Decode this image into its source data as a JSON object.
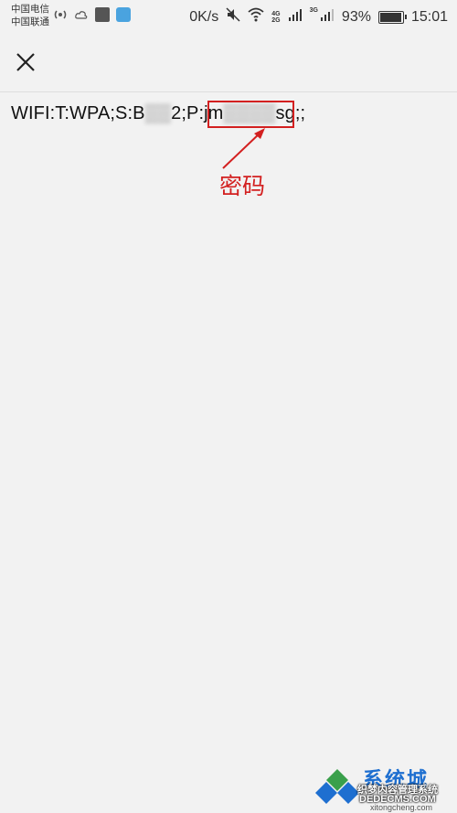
{
  "status_bar": {
    "carrier_1": "中国电信",
    "carrier_2": "中国联通",
    "net_speed": "0K/s",
    "net_4g": "4G",
    "net_2g": "2G",
    "net_3g": "3G",
    "battery": "93%",
    "time": "15:01",
    "icons": [
      "hotspot-icon",
      "weather-icon",
      "app-icon",
      "app-blue-icon",
      "mute-icon",
      "wifi-icon",
      "signal-icon",
      "signal-3g-icon",
      "battery-icon"
    ]
  },
  "toolbar": {
    "close_icon": "close-icon"
  },
  "content": {
    "prefix": "WIFI:T:WPA;S:B",
    "ssid_hidden": "▒▒",
    "ssid_tail": "2;P:",
    "pwd_start": "jm",
    "pwd_hidden": "▒▒▒▒",
    "pwd_end": "sg",
    "suffix": ";;"
  },
  "annotation": {
    "label": "密码",
    "color": "#d32020"
  },
  "watermark": {
    "title": "系统城",
    "subtitle": "织梦内容管理系统",
    "dede": "DEDECMS.COM",
    "url": "xitongcheng.com"
  }
}
